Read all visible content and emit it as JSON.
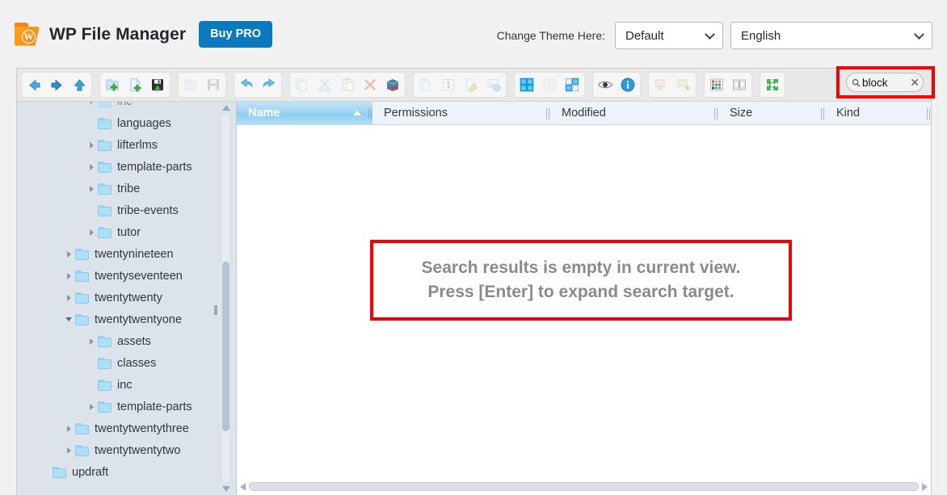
{
  "header": {
    "app_title": "WP File Manager",
    "logo_icon": "wordpress-folder-logo",
    "logo_glyph": "W",
    "buy_pro_label": "Buy PRO",
    "theme_label": "Change Theme Here:",
    "theme_value": "Default",
    "language_value": "English",
    "accent_color": "#0b79bf",
    "logo_color": "#f7971d"
  },
  "toolbar": {
    "groups": [
      {
        "name": "navigation",
        "buttons": [
          {
            "name": "back-button",
            "icon": "arrow-left-icon",
            "disabled": false
          },
          {
            "name": "forward-button",
            "icon": "arrow-right-icon",
            "disabled": false
          },
          {
            "name": "up-button",
            "icon": "arrow-up-icon",
            "disabled": false
          }
        ]
      },
      {
        "name": "create",
        "buttons": [
          {
            "name": "new-folder-button",
            "icon": "folder-add-icon",
            "disabled": false
          },
          {
            "name": "new-file-button",
            "icon": "file-add-icon",
            "disabled": false
          },
          {
            "name": "upload-button",
            "icon": "floppy-save-icon",
            "disabled": false
          }
        ]
      },
      {
        "name": "open",
        "buttons": [
          {
            "name": "open-button",
            "icon": "open-folder-icon",
            "disabled": true
          },
          {
            "name": "save-button",
            "icon": "floppy-disk-icon",
            "disabled": true
          }
        ]
      },
      {
        "name": "history",
        "buttons": [
          {
            "name": "undo-button",
            "icon": "undo-arrow-icon",
            "disabled": false
          },
          {
            "name": "redo-button",
            "icon": "redo-arrow-icon",
            "disabled": false
          }
        ]
      },
      {
        "name": "clipboard",
        "buttons": [
          {
            "name": "copy-button",
            "icon": "copy-icon",
            "disabled": true
          },
          {
            "name": "cut-button",
            "icon": "scissors-icon",
            "disabled": true
          },
          {
            "name": "paste-button",
            "icon": "clipboard-paste-icon",
            "disabled": true
          },
          {
            "name": "delete-button",
            "icon": "red-x-delete-icon",
            "disabled": true
          },
          {
            "name": "archive-button",
            "icon": "archive-box-icon",
            "disabled": false
          }
        ]
      },
      {
        "name": "edit",
        "buttons": [
          {
            "name": "duplicate-button",
            "icon": "duplicate-pages-icon",
            "disabled": true
          },
          {
            "name": "rename-button",
            "icon": "text-cursor-rename-icon",
            "disabled": true
          },
          {
            "name": "edit-file-button",
            "icon": "pencil-edit-icon",
            "disabled": true
          },
          {
            "name": "resize-image-button",
            "icon": "image-resize-icon",
            "disabled": true
          }
        ]
      },
      {
        "name": "view-mode",
        "buttons": [
          {
            "name": "icons-view-button",
            "icon": "grid-view-icon",
            "disabled": false,
            "active": true
          },
          {
            "name": "list-view-button",
            "icon": "list-view-icon",
            "disabled": true
          },
          {
            "name": "split-view-button",
            "icon": "split-view-icon",
            "disabled": false
          }
        ]
      },
      {
        "name": "inspect",
        "buttons": [
          {
            "name": "preview-button",
            "icon": "eye-preview-icon",
            "disabled": false
          },
          {
            "name": "info-button",
            "icon": "info-circle-icon",
            "disabled": false
          }
        ]
      },
      {
        "name": "archive-ops",
        "buttons": [
          {
            "name": "extract-button",
            "icon": "extract-archive-icon",
            "disabled": true
          },
          {
            "name": "compress-button",
            "icon": "compress-archive-icon",
            "disabled": true
          }
        ]
      },
      {
        "name": "extras",
        "buttons": [
          {
            "name": "color-palette-button",
            "icon": "color-grid-icon",
            "disabled": false
          },
          {
            "name": "help-button",
            "icon": "book-help-icon",
            "disabled": false
          }
        ]
      },
      {
        "name": "fullscreen-group",
        "buttons": [
          {
            "name": "fullscreen-button",
            "icon": "fullscreen-arrows-icon",
            "disabled": false
          }
        ]
      }
    ]
  },
  "search": {
    "icon": "search-icon",
    "value": "block",
    "clear_icon": "close-x-icon",
    "annotation_color": "#f40000"
  },
  "sidebar": {
    "scrollbar": {
      "name": "sidebar-vertical-scrollbar"
    },
    "tree": [
      {
        "label": "inc",
        "depth": 2,
        "arrow": "collapsed",
        "clipped": true
      },
      {
        "label": "languages",
        "depth": 2,
        "arrow": "none"
      },
      {
        "label": "lifterlms",
        "depth": 2,
        "arrow": "collapsed"
      },
      {
        "label": "template-parts",
        "depth": 2,
        "arrow": "collapsed"
      },
      {
        "label": "tribe",
        "depth": 2,
        "arrow": "collapsed"
      },
      {
        "label": "tribe-events",
        "depth": 2,
        "arrow": "none"
      },
      {
        "label": "tutor",
        "depth": 2,
        "arrow": "collapsed"
      },
      {
        "label": "twentynineteen",
        "depth": 1,
        "arrow": "collapsed"
      },
      {
        "label": "twentyseventeen",
        "depth": 1,
        "arrow": "collapsed"
      },
      {
        "label": "twentytwenty",
        "depth": 1,
        "arrow": "collapsed"
      },
      {
        "label": "twentytwentyone",
        "depth": 1,
        "arrow": "expanded"
      },
      {
        "label": "assets",
        "depth": 2,
        "arrow": "collapsed"
      },
      {
        "label": "classes",
        "depth": 2,
        "arrow": "none"
      },
      {
        "label": "inc",
        "depth": 2,
        "arrow": "none"
      },
      {
        "label": "template-parts",
        "depth": 2,
        "arrow": "collapsed"
      },
      {
        "label": "twentytwentythree",
        "depth": 1,
        "arrow": "collapsed"
      },
      {
        "label": "twentytwentytwo",
        "depth": 1,
        "arrow": "collapsed"
      },
      {
        "label": "updraft",
        "depth": 0,
        "arrow": "none"
      }
    ]
  },
  "file_pane": {
    "columns": [
      {
        "name": "name",
        "label": "Name",
        "active": true,
        "sort": "ascending"
      },
      {
        "name": "permissions",
        "label": "Permissions",
        "active": false
      },
      {
        "name": "modified",
        "label": "Modified",
        "active": false
      },
      {
        "name": "size",
        "label": "Size",
        "active": false
      },
      {
        "name": "kind",
        "label": "Kind",
        "active": false
      }
    ],
    "empty_message_line1": "Search results is empty in current view.",
    "empty_message_line2": "Press [Enter] to expand search target.",
    "horizontal_scrollbar": "pane-horizontal-scrollbar"
  }
}
